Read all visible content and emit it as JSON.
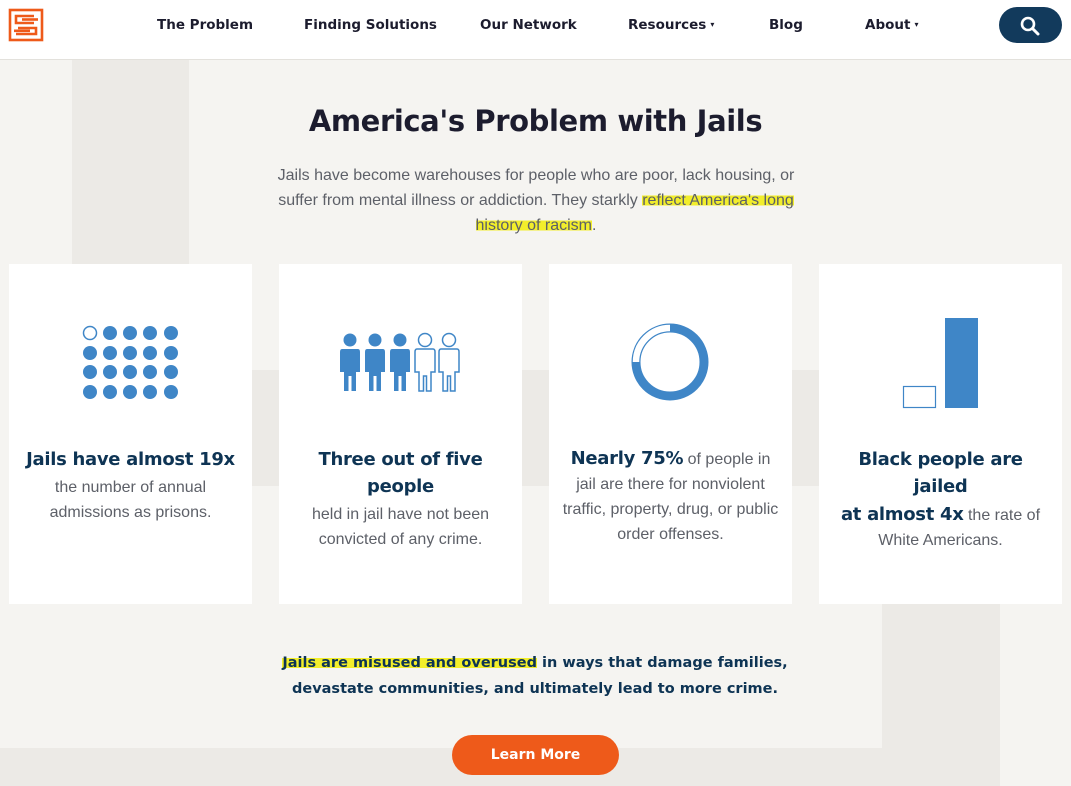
{
  "colors": {
    "accent": "#ee5a1a",
    "navy": "#123a5c",
    "icon_blue": "#3f86c7",
    "highlight": "#f2ee2b"
  },
  "logo": {
    "icon": "maze-logo-icon"
  },
  "nav": {
    "items": [
      {
        "label": "The Problem",
        "dropdown": false
      },
      {
        "label": "Finding Solutions",
        "dropdown": false
      },
      {
        "label": "Our Network",
        "dropdown": false
      },
      {
        "label": "Resources",
        "dropdown": true
      },
      {
        "label": "Blog",
        "dropdown": false
      },
      {
        "label": "About",
        "dropdown": true
      }
    ],
    "caret": "▾",
    "search_icon": "search-icon"
  },
  "hero": {
    "title": "America's Problem with Jails",
    "intro_part1": "Jails have become warehouses for people who are poor, lack housing, or suffer from mental illness or addiction. They starkly",
    "intro_highlight": "reflect America's long history of racism",
    "intro_end": "."
  },
  "cards": [
    {
      "icon": "dot-grid-icon",
      "head": "Jails have almost 19x",
      "text": "the number of annual admissions as prisons."
    },
    {
      "icon": "people-icon",
      "head": "Three out of five people",
      "text": "held in jail have not been convicted of any crime."
    },
    {
      "icon": "donut-chart-icon",
      "bold": "Nearly 75%",
      "text": " of people in jail are there for nonviolent traffic, property, drug, or public order offenses."
    },
    {
      "icon": "bar-comparison-icon",
      "head": "Black people are jailed",
      "bold": "at almost 4x",
      "text": " the rate of White Americans."
    }
  ],
  "bottom": {
    "highlight": "Jails are misused and overused",
    "rest": " in ways that damage families, devastate communities, and ultimately lead to more crime."
  },
  "cta": {
    "label": "Learn More"
  }
}
